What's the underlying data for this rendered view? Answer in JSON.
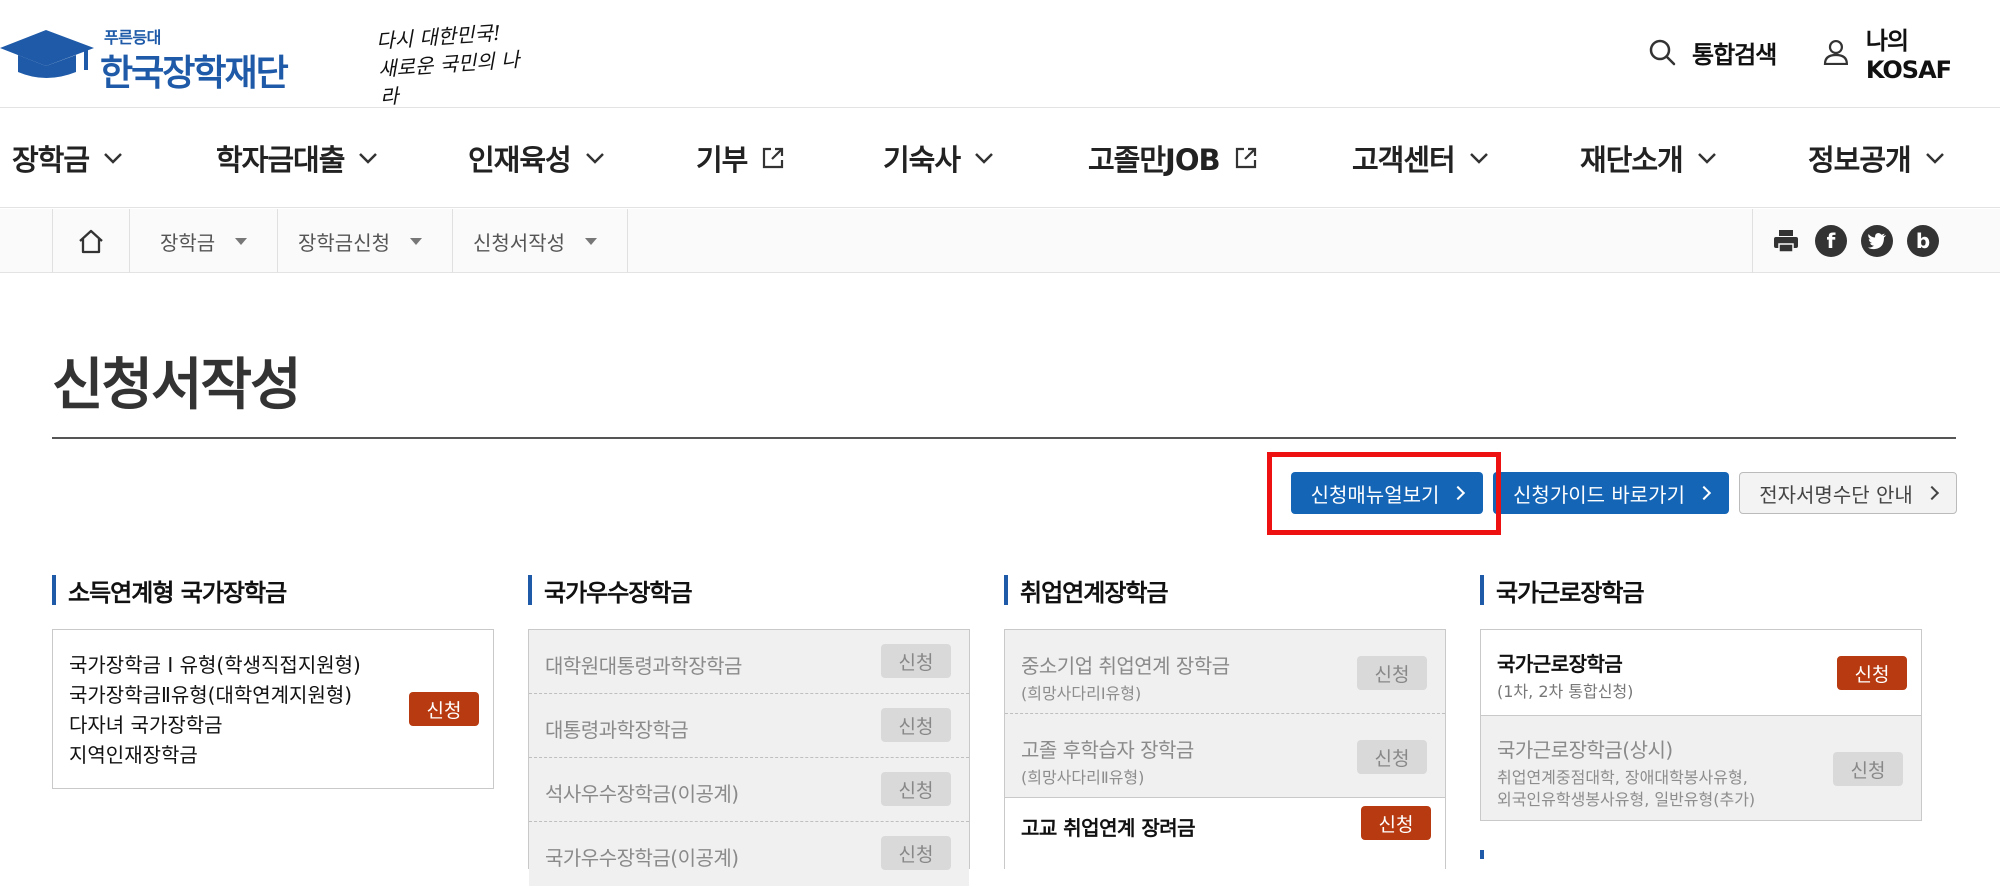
{
  "header": {
    "logo_top": "푸른등대",
    "logo_main": "한국장학재단",
    "slogan_line1": "다시 대한민국!",
    "slogan_line2": "새로운 국민의 나라",
    "search_label": "통합검색",
    "user_label": "나의 KOSAF"
  },
  "nav": {
    "items": [
      {
        "label": "장학금",
        "icon": "chevron-down-icon"
      },
      {
        "label": "학자금대출",
        "icon": "chevron-down-icon"
      },
      {
        "label": "인재육성",
        "icon": "chevron-down-icon"
      },
      {
        "label": "기부",
        "icon": "external-link-icon"
      },
      {
        "label": "기숙사",
        "icon": "chevron-down-icon"
      },
      {
        "label": "고졸만JOB",
        "icon": "external-link-icon"
      },
      {
        "label": "고객센터",
        "icon": "chevron-down-icon"
      },
      {
        "label": "재단소개",
        "icon": "chevron-down-icon"
      },
      {
        "label": "정보공개",
        "icon": "chevron-down-icon"
      }
    ]
  },
  "breadcrumb": {
    "items": [
      "장학금",
      "장학금신청",
      "신청서작성"
    ]
  },
  "share": {
    "facebook": "f",
    "blog": "b"
  },
  "page": {
    "title": "신청서작성"
  },
  "actions": {
    "manual": "신청매뉴얼보기",
    "guide": "신청가이드 바로가기",
    "esign": "전자서명수단 안내"
  },
  "apply_label": "신청",
  "sections": [
    {
      "title": "소득연계형 국가장학금",
      "lines": [
        "국가장학금 Ⅰ 유형(학생직접지원형)",
        "국가장학금Ⅱ유형(대학연계지원형)",
        "다자녀 국가장학금",
        "지역인재장학금"
      ]
    },
    {
      "title": "국가우수장학금",
      "rows": [
        "대학원대통령과학장학금",
        "대통령과학장학금",
        "석사우수장학금(이공계)",
        "국가우수장학금(이공계)"
      ]
    },
    {
      "title": "취업연계장학금",
      "rows": [
        {
          "name": "중소기업 취업연계 장학금",
          "sub": "(희망사다리Ⅰ유형)"
        },
        {
          "name": "고졸 후학습자 장학금",
          "sub": "(희망사다리Ⅱ유형)"
        },
        {
          "name": "고교 취업연계 장려금",
          "sub": ""
        }
      ]
    },
    {
      "title": "국가근로장학금",
      "rows": [
        {
          "name": "국가근로장학금",
          "sub": "(1차, 2차 통합신청)"
        },
        {
          "name": "국가근로장학금(상시)",
          "sub1": "취업연계중점대학, 장애대학봉사유형,",
          "sub2": "외국인유학생봉사유형, 일반유형(추가)"
        }
      ]
    }
  ],
  "colors": {
    "brand_blue": "#1e5aa8",
    "button_blue": "#1565b7",
    "apply_active": "#b73a10",
    "highlight": "#ee1111"
  }
}
